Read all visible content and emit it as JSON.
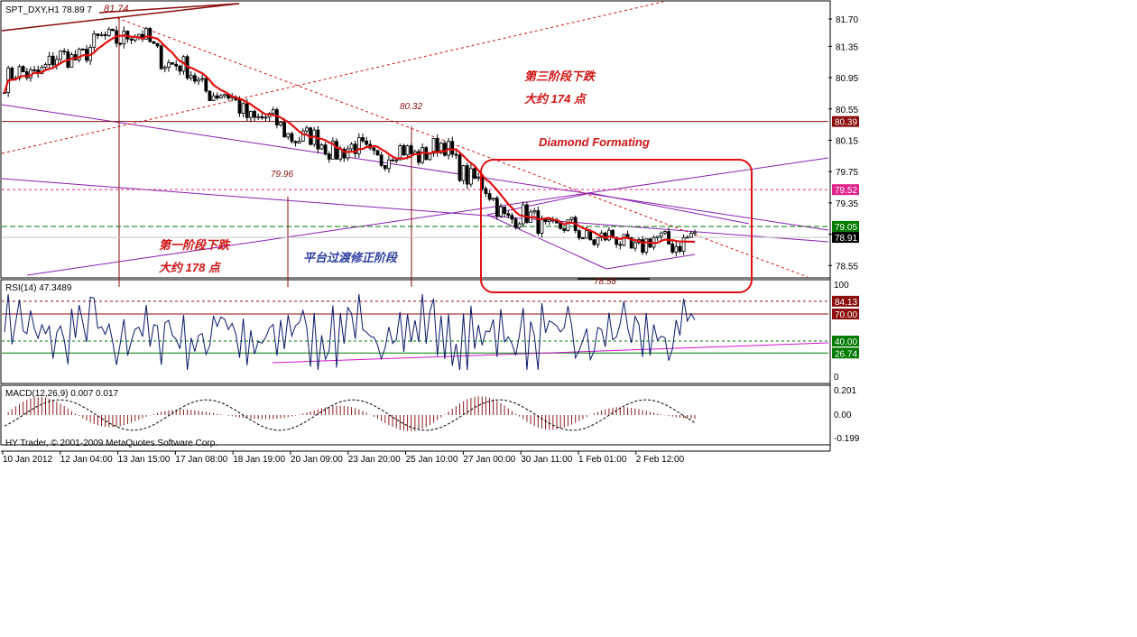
{
  "window": {
    "symbol_header": "SPT_DXY,H1  78.89 7",
    "copyright": "HY Trader, © 2001-2009 MetaQuotes Software Corp."
  },
  "price_axis": {
    "ticks": [
      "81.70",
      "81.35",
      "80.95",
      "80.55",
      "80.15",
      "79.75",
      "79.35",
      "78.95",
      "78.55"
    ],
    "ylim": [
      78.45,
      81.85
    ],
    "tags": [
      {
        "value": 80.39,
        "label": "80.39",
        "color": "#8b0d0d"
      },
      {
        "value": 79.52,
        "label": "79.52",
        "color": "#e0248a"
      },
      {
        "value": 79.05,
        "label": "79.05",
        "color": "#007a00"
      },
      {
        "value": 78.91,
        "label": "78.91",
        "color": "#000000"
      }
    ]
  },
  "time_axis": {
    "labels": [
      "10 Jan 2012",
      "12 Jan 04:00",
      "13 Jan 15:00",
      "17 Jan 08:00",
      "18 Jan 19:00",
      "20 Jan 09:00",
      "23 Jan 20:00",
      "25 Jan 10:00",
      "27 Jan 00:00",
      "30 Jan 11:00",
      "1 Feb 01:00",
      "2 Feb 12:00"
    ]
  },
  "annotations": {
    "high_label": "81.74",
    "mid_high_label": "80.32",
    "mid_low_label": "79.96",
    "low_label": "78.58",
    "stage1_line1": "第一阶段下跌",
    "stage1_line2": "大约 178 点",
    "stage2": "平台过渡修正阶段",
    "stage3_line1": "第三阶段下跌",
    "stage3_line2": "大约 174 点",
    "diamond": "Diamond Formating"
  },
  "rsi_panel": {
    "title": "RSI(14) 47.3489",
    "scale_top": "100",
    "scale_bottom": "0",
    "levels": [
      {
        "value": 84.13,
        "label": "84.13",
        "color": "#8b0d0d"
      },
      {
        "value": 70.0,
        "label": "70.00",
        "color": "#8b0d0d"
      },
      {
        "value": 40.0,
        "label": "40.00",
        "color": "#007a00"
      },
      {
        "value": 26.74,
        "label": "26.74",
        "color": "#007a00"
      }
    ]
  },
  "macd_panel": {
    "title": "MACD(12,26,9) 0.007 0.017",
    "ticks": [
      "0.201",
      "0.00",
      "-0.199"
    ]
  },
  "colors": {
    "candle": "#000000",
    "ma": "#e01010",
    "trend": "#8a1fb0",
    "resistance": "#8b0d0d",
    "diamond_box": "#e01010",
    "rsi_line": "#0a1a6a",
    "macd_hist": "#8b1a1a"
  },
  "chart_data": {
    "type": "candlestick",
    "title": "SPT_DXY,H1",
    "interval": "H1",
    "y_range": [
      78.45,
      81.85
    ],
    "key_levels": {
      "high": 81.74,
      "lower_high": 80.32,
      "stage_low": 79.96,
      "diamond_low": 78.58,
      "resistance": 80.39,
      "upper_marker": 79.52,
      "green_marker": 79.05,
      "last_price": 78.91
    },
    "approx_close_path": {
      "x": [
        "10 Jan 2012",
        "12 Jan 04:00",
        "13 Jan 15:00",
        "17 Jan 08:00",
        "18 Jan 19:00",
        "20 Jan 09:00",
        "23 Jan 20:00",
        "25 Jan 10:00",
        "27 Jan 00:00",
        "30 Jan 11:00",
        "1 Feb 01:00",
        "2 Feb 12:00"
      ],
      "y": [
        80.9,
        81.2,
        81.55,
        80.95,
        80.45,
        80.1,
        79.95,
        80.05,
        79.2,
        79.0,
        78.8,
        78.91
      ]
    },
    "rsi_last": 47.3489,
    "macd": {
      "main": 0.007,
      "signal": 0.017
    }
  }
}
